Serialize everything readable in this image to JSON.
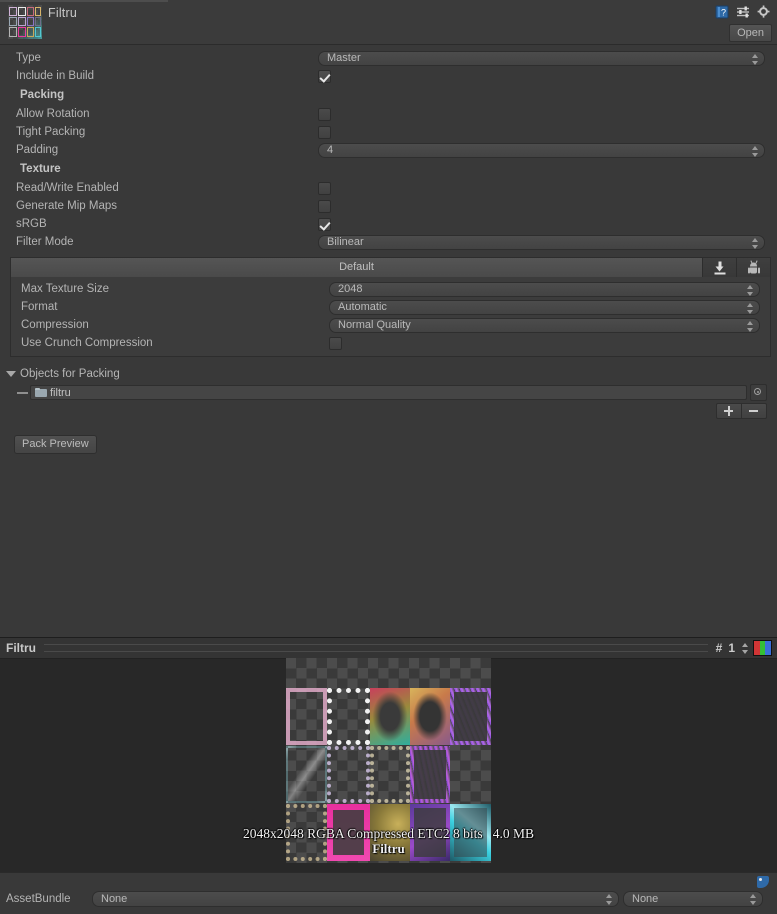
{
  "header": {
    "title": "Filtru",
    "thumbnail_name": "sprite-atlas-thumbnail",
    "icons": [
      {
        "name": "help-icon",
        "label": "?"
      },
      {
        "name": "preset-icon",
        "label": ""
      },
      {
        "name": "gear-icon",
        "label": ""
      }
    ],
    "open_button": "Open"
  },
  "inspector": {
    "type_label": "Type",
    "type_value": "Master",
    "include_in_build_label": "Include in Build",
    "include_in_build_checked": true,
    "packing_section": "Packing",
    "allow_rotation_label": "Allow Rotation",
    "allow_rotation_checked": false,
    "tight_packing_label": "Tight Packing",
    "tight_packing_checked": false,
    "padding_label": "Padding",
    "padding_value": "4",
    "texture_section": "Texture",
    "read_write_label": "Read/Write Enabled",
    "read_write_checked": false,
    "mipmaps_label": "Generate Mip Maps",
    "mipmaps_checked": false,
    "srgb_label": "sRGB",
    "srgb_checked": true,
    "filter_mode_label": "Filter Mode",
    "filter_mode_value": "Bilinear"
  },
  "platform": {
    "default_tab": "Default",
    "tabs": [
      {
        "name": "standalone-platform-tab",
        "icon": "download-icon"
      },
      {
        "name": "android-platform-tab",
        "icon": "android-icon"
      }
    ],
    "max_texture_size_label": "Max Texture Size",
    "max_texture_size_value": "2048",
    "format_label": "Format",
    "format_value": "Automatic",
    "compression_label": "Compression",
    "compression_value": "Normal Quality",
    "crunch_label": "Use Crunch Compression",
    "crunch_checked": false
  },
  "objects_for_packing": {
    "foldout_label": "Objects for Packing",
    "entries": [
      {
        "icon": "folder-icon",
        "value": "filtru"
      }
    ],
    "add_button": "+",
    "remove_button": "−",
    "pack_preview_button": "Pack Preview"
  },
  "preview": {
    "title": "Filtru",
    "page_hash": "#",
    "page_number": "1",
    "rgb_swatch_name": "rgb-channel-swatch",
    "overlay_label": "Filtru",
    "info_text": "2048x2048 RGBA Compressed ETC2 8 bits   4.0 MB"
  },
  "footer": {
    "tag_icon": "asset-label-tag-icon",
    "assetbundle_label": "AssetBundle",
    "assetbundle_value": "None",
    "assetbundle_variant_value": "None"
  },
  "colors": {
    "background": "#383838",
    "panel": "#3c3c3c",
    "preview_background": "#282828",
    "text": "#b4b4b4",
    "accent_blue": "#2f6aa8"
  }
}
